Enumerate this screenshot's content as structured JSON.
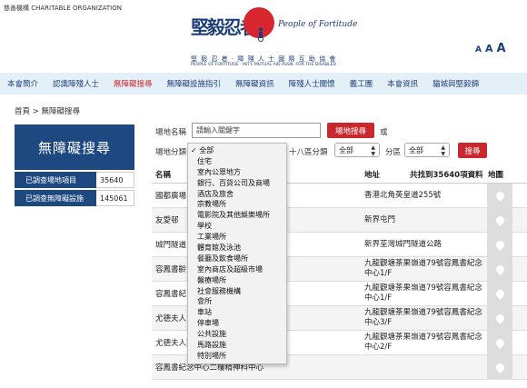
{
  "org_line": "慈善機構 CHARITABLE ORGANIZATION",
  "logo": {
    "cn": "堅毅忍者",
    "en": "People of Fortitude",
    "sub1": "堅 毅 忍 者 · 障 殘 人 士 國 際 互 助 協 會",
    "sub2": "PEOPLE OF FORTITUDE · INT'L MUTUAL AID ASSN. FOR THE DISABLED"
  },
  "font_sizes": [
    "A",
    "A",
    "A"
  ],
  "nav": [
    "本會簡介",
    "認識障殘人士",
    "無障礙搜尋",
    "無障礙設施指引",
    "無障礙資訊",
    "障殘人士關懷",
    "義工團",
    "本會資訊",
    "貓城與堅毅錦"
  ],
  "breadcrumb": "首頁 > 無障礙搜尋",
  "side": {
    "title": "無障礙搜尋",
    "stats": [
      {
        "label": "已調查場地項目",
        "value": "35640"
      },
      {
        "label": "已調查無障礙設施",
        "value": "145061"
      }
    ]
  },
  "search": {
    "name_label": "場地名稱",
    "placeholder": "請輸入關鍵字",
    "button": "場地搜尋",
    "or": "或",
    "category_label": "場地分類",
    "district18_label": "十八區分類",
    "district18_value": "全部",
    "district_label": "分區",
    "district_value": "全部",
    "submit": "搜尋"
  },
  "table": {
    "col_name": "名稱",
    "col_addr": "地址",
    "total": "共找到35640項資料",
    "col_map": "地圖",
    "rows": [
      {
        "name": "國都廣場",
        "addr": "香港北角英皇道255號"
      },
      {
        "name": "友愛邨",
        "addr": "新界屯門"
      },
      {
        "name": "城門隧道",
        "addr": "新界荃灣城門隧道公路"
      },
      {
        "name": "容鳳書齡",
        "addr": "九龍觀塘茶果嶺道79號容鳳書紀念中心1/F"
      },
      {
        "name": "容鳳書紀",
        "addr": "九龍觀塘茶果嶺道79號容鳳書紀念中心1/F"
      },
      {
        "name": "尤德夫人",
        "addr": "九龍觀塘茶果嶺道79號容鳳書紀念中心3/F"
      },
      {
        "name": "尤德夫人那打素醫院",
        "addr": "九龍觀塘茶果嶺道79號容鳳書紀念中心2/F"
      },
      {
        "name": "容鳳書紀念中心二樓精神科中心",
        "addr": ""
      }
    ]
  },
  "category_dropdown": {
    "selected": "全部",
    "options": [
      "全部",
      "住宅",
      "室內公眾地方",
      "銀行、百貨公司及商場",
      "酒店及旅舍",
      "宗教場所",
      "電影院及其他娛樂場所",
      "學校",
      "工業場所",
      "體育館及泳池",
      "餐廳及飲食場所",
      "室內商店及超級市場",
      "醫療場所",
      "社會服務機構",
      "會所",
      "車站",
      "停車場",
      "公共設施",
      "馬路設施",
      "特別場所"
    ]
  }
}
